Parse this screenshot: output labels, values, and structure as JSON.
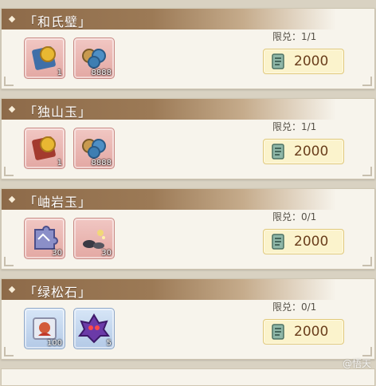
{
  "shop_items": [
    {
      "title": "「和氏璧」",
      "limit": "限兑：1/1",
      "price": "2000",
      "rewards": [
        {
          "icon": "skill-book-gold-coin-icon",
          "count": "1",
          "frame": "red"
        },
        {
          "icon": "blue-coin-pile-icon",
          "count": "8888",
          "frame": "red"
        }
      ]
    },
    {
      "title": "「独山玉」",
      "limit": "限兑：1/1",
      "price": "2000",
      "rewards": [
        {
          "icon": "red-book-gold-coin-icon",
          "count": "1",
          "frame": "red"
        },
        {
          "icon": "blue-coin-pile-icon",
          "count": "8888",
          "frame": "red"
        }
      ]
    },
    {
      "title": "「岫岩玉」",
      "limit": "限兑：0/1",
      "price": "2000",
      "rewards": [
        {
          "icon": "puzzle-piece-icon",
          "count": "30",
          "frame": "red"
        },
        {
          "icon": "stone-rubble-icon",
          "count": "30",
          "frame": "red"
        }
      ]
    },
    {
      "title": "「绿松石」",
      "limit": "限兑：0/1",
      "price": "2000",
      "rewards": [
        {
          "icon": "character-card-icon",
          "count": "100",
          "frame": "blue"
        },
        {
          "icon": "purple-creature-icon",
          "count": "5",
          "frame": "blue"
        }
      ]
    }
  ],
  "watermark": "@悟天",
  "colors": {
    "banner": "#9c7a56",
    "price_bg": "#fbf3cc",
    "price_text": "#6a3e1c"
  }
}
